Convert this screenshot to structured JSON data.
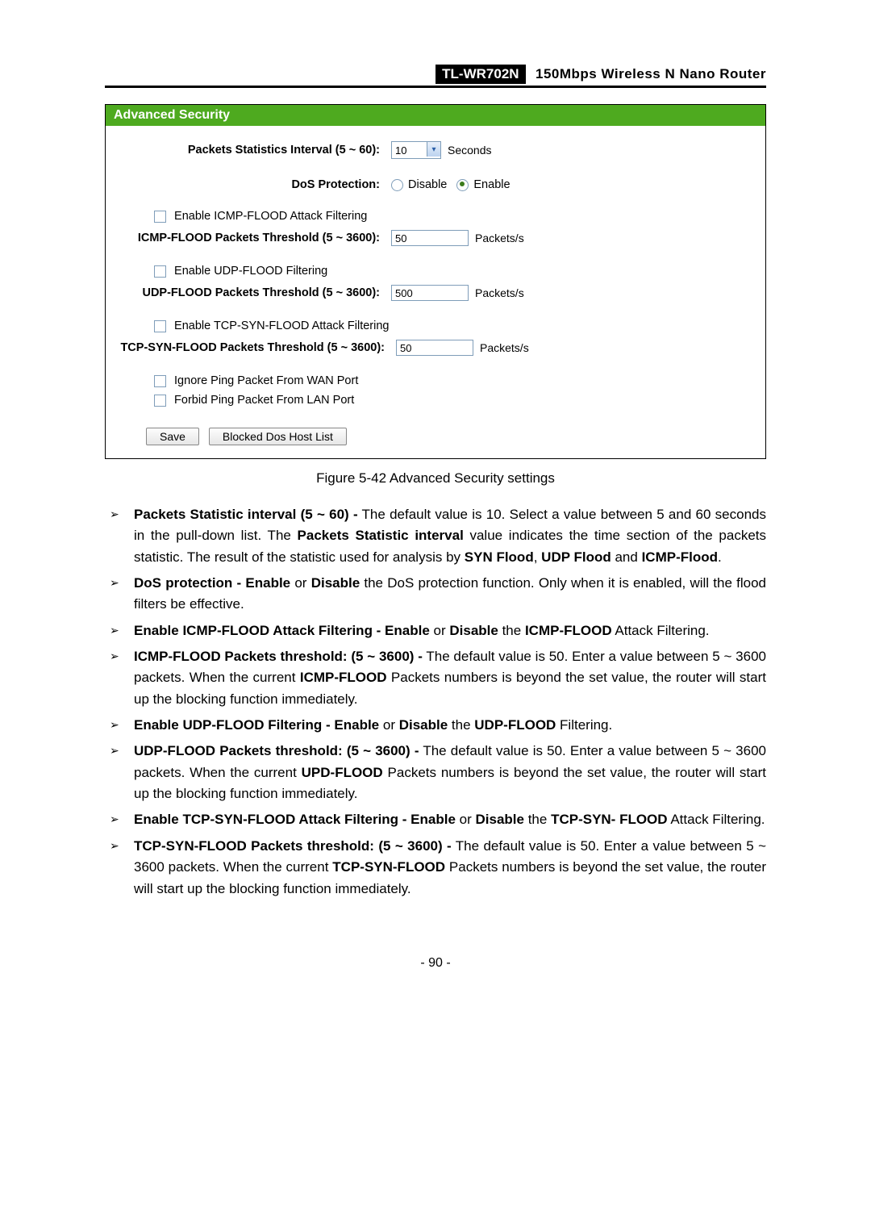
{
  "header": {
    "model": "TL-WR702N",
    "desc": "150Mbps  Wireless  N  Nano  Router"
  },
  "figure": {
    "title": "Advanced Security",
    "rows": {
      "pkt_interval_label": "Packets Statistics Interval (5 ~ 60):",
      "pkt_interval_value": "10",
      "pkt_interval_unit": "Seconds",
      "dos_label": "DoS Protection:",
      "dos_disable": "Disable",
      "dos_enable": "Enable",
      "icmp_cb": "Enable ICMP-FLOOD Attack Filtering",
      "icmp_thresh_label": "ICMP-FLOOD Packets Threshold (5 ~ 3600):",
      "icmp_thresh_value": "50",
      "udp_cb": "Enable UDP-FLOOD Filtering",
      "udp_thresh_label": "UDP-FLOOD Packets Threshold (5 ~ 3600):",
      "udp_thresh_value": "500",
      "tcp_cb": "Enable TCP-SYN-FLOOD Attack Filtering",
      "tcp_thresh_label": "TCP-SYN-FLOOD Packets Threshold (5 ~ 3600):",
      "tcp_thresh_value": "50",
      "pktsps": "Packets/s",
      "wan_cb": "Ignore Ping Packet From WAN Port",
      "lan_cb": "Forbid Ping Packet From LAN Port",
      "save_btn": "Save",
      "blocked_btn": "Blocked Dos Host List"
    },
    "caption": "Figure 5-42 Advanced Security settings"
  },
  "bullets": [
    "<b>Packets Statistic interval (5 ~ 60) -</b> The default value is 10. Select a value between 5 and 60 seconds in the pull-down list. The <b>Packets Statistic interval</b> value indicates the time section of the packets statistic. The result of the statistic used for analysis by <b>SYN Flood</b>, <b>UDP Flood</b> and <b>ICMP-Flood</b>.",
    "<b>DoS protection - Enable</b> or <b>Disable</b> the DoS protection function. Only when it is enabled, will the flood filters be effective.",
    "<b>Enable ICMP-FLOOD Attack Filtering - Enable</b> or <b>Disable</b> the <b>ICMP-FLOOD</b> Attack Filtering.",
    "<b>ICMP-FLOOD Packets threshold: (5 ~ 3600) -</b> The default value is 50. Enter a value between 5 ~ 3600 packets. When the current <b>ICMP-FLOOD</b> Packets numbers is beyond the set value, the router will start up the blocking function immediately.",
    "<b>Enable UDP-FLOOD Filtering - Enable</b> or <b>Disable</b> the <b>UDP-FLOOD</b> Filtering.",
    "<b>UDP-FLOOD Packets threshold: (5 ~ 3600) -</b> The default value is 50. Enter a value between 5 ~ 3600 packets. When the current <b>UPD-FLOOD</b> Packets numbers is beyond the set value, the router will start up the blocking function immediately.",
    "<b>Enable TCP-SYN-FLOOD Attack Filtering - Enable</b> or <b>Disable</b> the <b>TCP-SYN- FLOOD</b> Attack Filtering.",
    "<b>TCP-SYN-FLOOD Packets threshold: (5 ~ 3600) -</b> The default value is 50. Enter a value between 5 ~ 3600 packets. When the current <b>TCP-SYN-FLOOD</b> Packets numbers is beyond the set value, the router will start up the blocking function immediately."
  ],
  "footer": "- 90 -"
}
